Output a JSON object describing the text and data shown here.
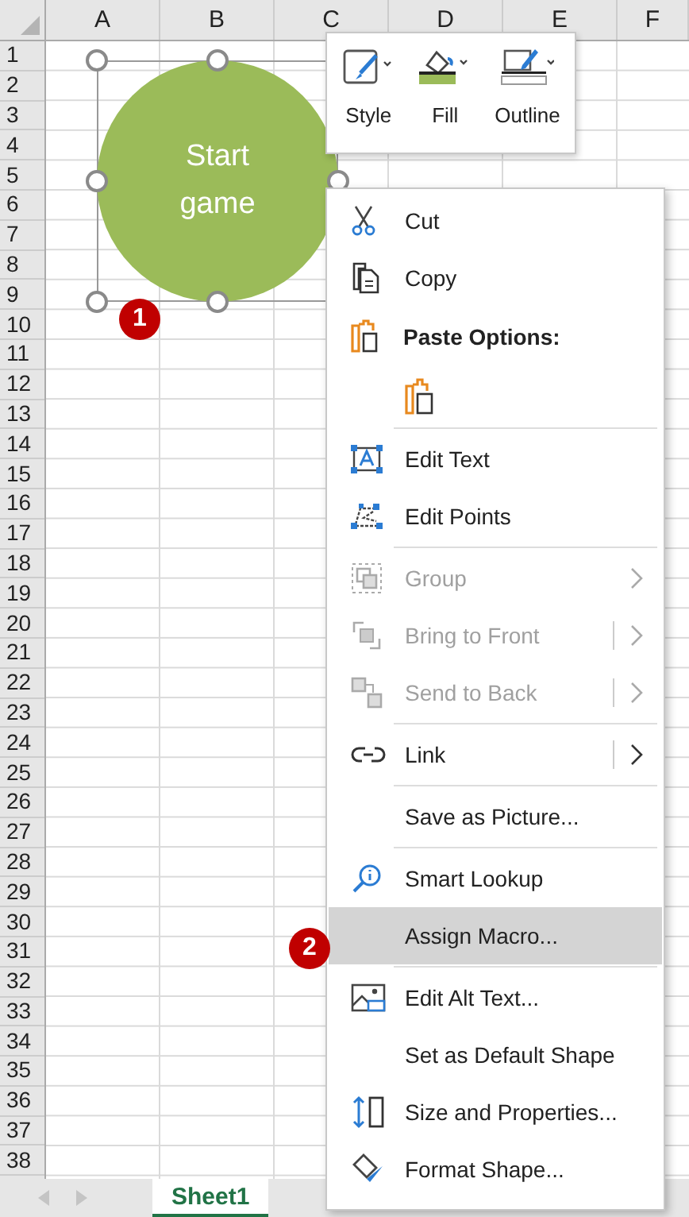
{
  "column_headers": [
    "A",
    "B",
    "C",
    "D",
    "E",
    "F"
  ],
  "row_headers": [
    "1",
    "2",
    "3",
    "4",
    "5",
    "6",
    "7",
    "8",
    "9",
    "10",
    "11",
    "12",
    "13",
    "14",
    "15",
    "16",
    "17",
    "18",
    "19",
    "20",
    "21",
    "22",
    "23",
    "24",
    "25",
    "26",
    "27",
    "28",
    "29",
    "30",
    "31",
    "32",
    "33",
    "34",
    "35",
    "36",
    "37",
    "38"
  ],
  "shape": {
    "text": "Start game",
    "selected": true
  },
  "mini_toolbar": [
    {
      "kind": "style",
      "label": "Style"
    },
    {
      "kind": "fill",
      "label": "Fill"
    },
    {
      "kind": "outline",
      "label": "Outline"
    }
  ],
  "context_menu": [
    {
      "kind": "cut",
      "label": "Cut",
      "disabled": false,
      "selected": false
    },
    {
      "kind": "copy",
      "label": "Copy",
      "disabled": false,
      "selected": false
    },
    {
      "kind": "header",
      "label": "Paste Options:"
    },
    {
      "kind": "paste"
    },
    {
      "kind": "separator"
    },
    {
      "kind": "edit-text",
      "label": "Edit Text",
      "disabled": false,
      "selected": false
    },
    {
      "kind": "edit-points",
      "label": "Edit Points",
      "disabled": false,
      "selected": false
    },
    {
      "kind": "separator"
    },
    {
      "kind": "group",
      "label": "Group",
      "disabled": true,
      "selected": false,
      "submenu": true,
      "split": false
    },
    {
      "kind": "front",
      "label": "Bring to Front",
      "disabled": true,
      "selected": false,
      "submenu": true,
      "split": true
    },
    {
      "kind": "back",
      "label": "Send to Back",
      "disabled": true,
      "selected": false,
      "submenu": true,
      "split": true
    },
    {
      "kind": "separator"
    },
    {
      "kind": "link",
      "label": "Link",
      "disabled": false,
      "selected": false,
      "submenu": true,
      "split": true
    },
    {
      "kind": "separator"
    },
    {
      "kind": "plain",
      "label": "Save as Picture...",
      "disabled": false,
      "selected": false
    },
    {
      "kind": "separator"
    },
    {
      "kind": "lookup",
      "label": "Smart Lookup",
      "disabled": false,
      "selected": false
    },
    {
      "kind": "plain",
      "label": "Assign Macro...",
      "disabled": false,
      "selected": true
    },
    {
      "kind": "separator"
    },
    {
      "kind": "alt-text",
      "label": "Edit Alt Text...",
      "disabled": false,
      "selected": false
    },
    {
      "kind": "plain",
      "label": "Set as Default Shape",
      "disabled": false,
      "selected": false
    },
    {
      "kind": "size",
      "label": "Size and Properties...",
      "disabled": false,
      "selected": false
    },
    {
      "kind": "format",
      "label": "Format Shape...",
      "disabled": false,
      "selected": false
    }
  ],
  "callouts": [
    "1",
    "2"
  ],
  "sheet_tabs": [
    {
      "label": "Sheet1",
      "selected": true
    }
  ]
}
